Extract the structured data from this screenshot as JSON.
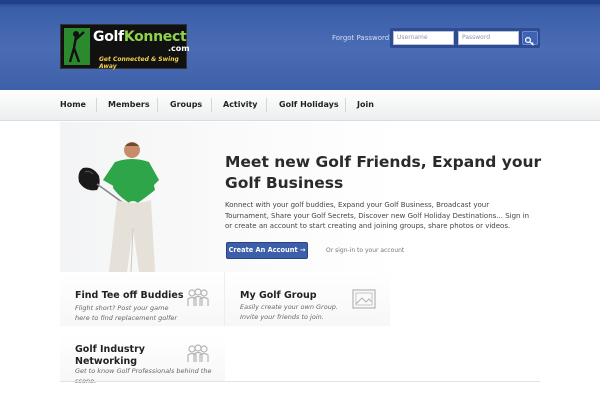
{
  "header": {
    "logo": {
      "brand_golf": "Golf",
      "brand_konnect": "Konnect",
      "dotcom": ".com",
      "tagline": "Get Connected & Swing Away"
    },
    "forgot_password": "Forgot Password?",
    "username_placeholder": "Username",
    "password_placeholder": "Password",
    "search_icon": "key-icon"
  },
  "nav": {
    "items": [
      "Home",
      "Members",
      "Groups",
      "Activity",
      "Golf Holidays",
      "Join"
    ]
  },
  "hero": {
    "title": "Meet new Golf Friends, Expand your Golf Business",
    "description": "Konnect with your golf buddies, Expand your Golf Business, Broadcast your Tournament, Share your Golf Secrets, Discover new Golf Holiday Destinations... Sign in or create an account to start creating and joining groups, share photos or videos.",
    "cta_label": "Create An Account →",
    "signin_text": "Or sign-in to your account"
  },
  "features": [
    {
      "title": "Find Tee off Buddies",
      "description": "Flight short? Post your game here to find replacement golfer",
      "icon": "people-icon"
    },
    {
      "title": "My Golf Group",
      "description": "Easily create your own Group. Invite your friends to join.",
      "icon": "photo-icon"
    },
    {
      "title": "Golf Industry Networking",
      "description": "Get to know Golf Professionals behind the scene.",
      "icon": "people-icon"
    }
  ],
  "colors": {
    "header_blue": "#3d5fa8",
    "cta_blue": "#3d5ea8",
    "nav_text": "#222222"
  }
}
